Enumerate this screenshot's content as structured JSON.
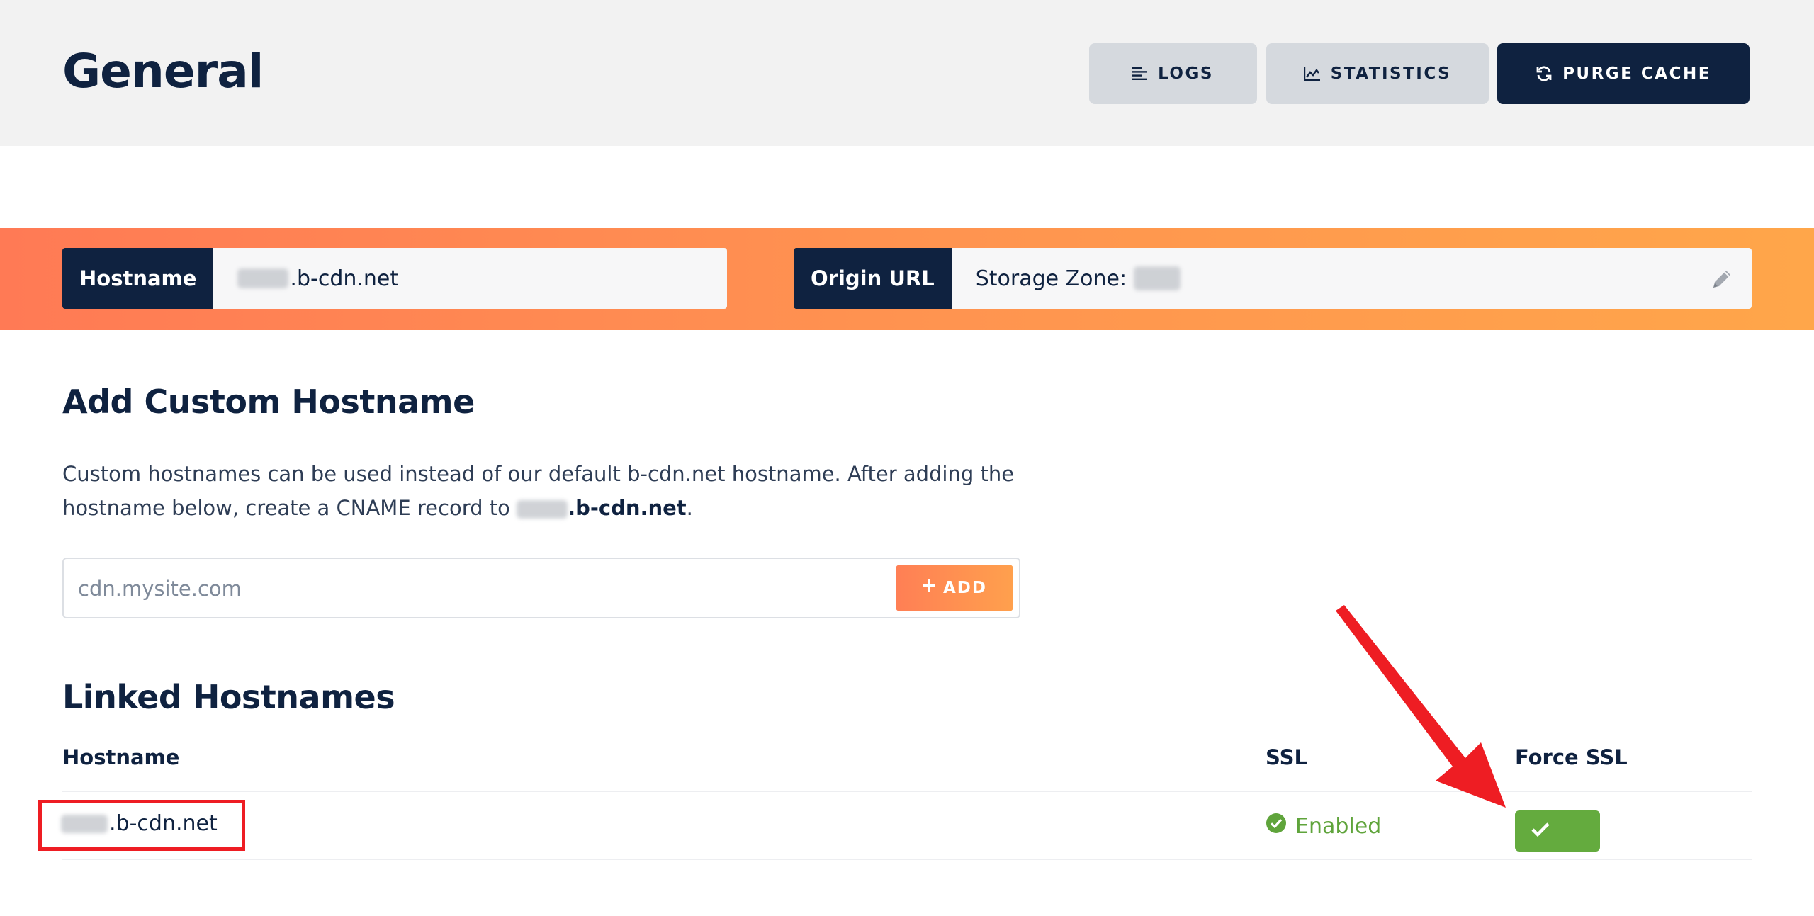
{
  "header": {
    "title": "General",
    "buttons": {
      "logs": "LOGS",
      "statistics": "STATISTICS",
      "purge_cache": "PURGE CACHE"
    }
  },
  "zone_info": {
    "hostname_label": "Hostname",
    "hostname_value_suffix": ".b-cdn.net",
    "origin_label": "Origin URL",
    "origin_value_prefix": "Storage Zone:"
  },
  "add_custom": {
    "title": "Add Custom Hostname",
    "description_part1": "Custom hostnames can be used instead of our default b-cdn.net hostname. After adding the hostname below, create a CNAME record to ",
    "description_cname_suffix": ".b-cdn.net",
    "description_end": ".",
    "input_placeholder": "cdn.mysite.com",
    "add_button": "ADD"
  },
  "linked": {
    "title": "Linked Hostnames",
    "columns": {
      "hostname": "Hostname",
      "ssl": "SSL",
      "force_ssl": "Force SSL"
    },
    "rows": [
      {
        "hostname_suffix": ".b-cdn.net",
        "ssl_status": "Enabled"
      }
    ]
  },
  "colors": {
    "navy": "#0f2240",
    "orange_start": "#ff7a55",
    "orange_end": "#ffa64a",
    "green": "#64ab3e",
    "annotation_red": "#ee1d23"
  },
  "icons": {
    "logs": "list-lines-icon",
    "statistics": "area-chart-icon",
    "purge": "refresh-icon",
    "edit": "pencil-icon",
    "add": "plus-icon",
    "ssl": "check-circle-icon",
    "force_ssl": "checkmark-icon"
  }
}
